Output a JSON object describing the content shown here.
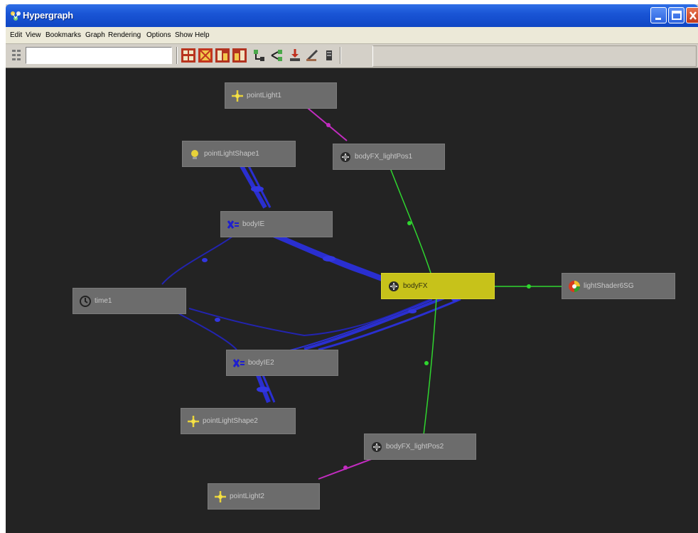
{
  "window": {
    "title": "Hypergraph",
    "min_label": "minimize",
    "max_label": "maximize",
    "close_label": "close"
  },
  "menu": {
    "items": [
      "Edit",
      "View",
      "Bookmarks",
      "Graph",
      "Rendering",
      "Options",
      "Show",
      "Help"
    ]
  },
  "toolbar": {
    "input_value": "",
    "buttons": [
      "scene-hierarchy-icon",
      "input-output-icon",
      "input-connections-icon",
      "output-connections-icon",
      "upstream-icon",
      "downstream-icon",
      "import-icon",
      "edit-icon",
      "clear-icon"
    ]
  },
  "graph": {
    "nodes": {
      "pointLight1": {
        "label": "pointLight1",
        "icon": "light-transform-icon"
      },
      "pointLightShape1": {
        "label": "pointLightShape1",
        "icon": "light-shape-icon"
      },
      "bodyFX_lightPos1": {
        "label": "bodyFX_lightPos1",
        "icon": "utility-node-icon"
      },
      "bodyIE": {
        "label": "bodyIE",
        "icon": "expression-icon"
      },
      "time1": {
        "label": "time1",
        "icon": "time-icon"
      },
      "bodyFX": {
        "label": "bodyFX",
        "icon": "utility-node-icon"
      },
      "lightShader": {
        "label": "lightShader6SG",
        "icon": "shading-group-icon"
      },
      "bodyIE2": {
        "label": "bodyIE2",
        "icon": "expression-icon"
      },
      "pointLightShape2": {
        "label": "pointLightShape2",
        "icon": "light-transform-icon"
      },
      "bodyFX_lightPos2": {
        "label": "bodyFX_lightPos2",
        "icon": "utility-node-icon"
      },
      "pointLight2": {
        "label": "pointLight2",
        "icon": "light-transform-icon"
      }
    }
  },
  "colors": {
    "canvas_bg": "#232323",
    "node_bg": "#6c6c6c",
    "node_selected": "#c7c21a",
    "edge_blue": "#2a2fd0",
    "edge_green": "#2fd62f",
    "edge_magenta": "#c22cc0",
    "titlebar": "#1a55d6"
  }
}
